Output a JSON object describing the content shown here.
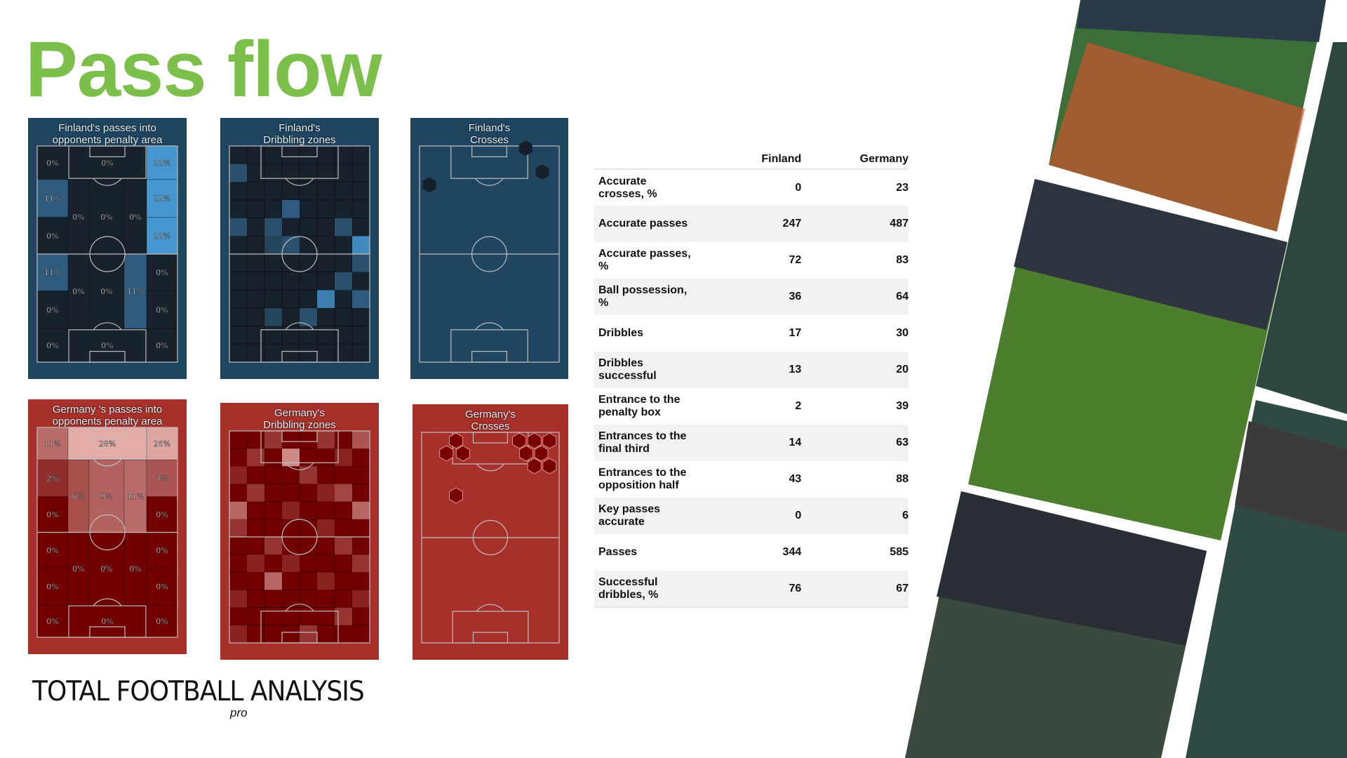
{
  "title": "Pass flow",
  "colors": {
    "title": "#7cbf4a",
    "finland_bg": "#1f4560",
    "germany_bg": "#a8302a",
    "finland_dark": "#17222c",
    "finland_high": "#4696cf",
    "germany_dark": "#730000",
    "germany_high": "#e3aca7"
  },
  "panels": {
    "finland_penalty": {
      "title1": "Finland's passes into",
      "title2": "opponents penalty area",
      "values": [
        "0%",
        "0%",
        "22%",
        "11%",
        "0%",
        "0%",
        "0%",
        "0%",
        "22%",
        "22%",
        "11%",
        "0%",
        "0%",
        "0%",
        "11%",
        "0%",
        "0%",
        "0%",
        "0%",
        "0%"
      ]
    },
    "finland_dribbling": {
      "title1": "Finland's",
      "title2": "Dribbling zones",
      "cells": [
        [
          1,
          0,
          0.4
        ],
        [
          3,
          3,
          0.5
        ],
        [
          4,
          0,
          0.4
        ],
        [
          4,
          2,
          0.4
        ],
        [
          4,
          6,
          0.4
        ],
        [
          5,
          2,
          0.3
        ],
        [
          5,
          3,
          0.4
        ],
        [
          5,
          7,
          0.9
        ],
        [
          6,
          7,
          0.4
        ],
        [
          7,
          6,
          0.4
        ],
        [
          8,
          5,
          0.8
        ],
        [
          8,
          7,
          0.5
        ],
        [
          9,
          4,
          0.4
        ],
        [
          9,
          2,
          0.3
        ]
      ]
    },
    "finland_crosses": {
      "title1": "Finland's",
      "title2": "Crosses",
      "points": [
        [
          0.07,
          0.18
        ],
        [
          0.88,
          0.12
        ],
        [
          0.76,
          0.01
        ]
      ]
    },
    "germany_penalty": {
      "title1": "Germany 's passes into",
      "title2": "opponents penalty area",
      "values": [
        "11%",
        "28%",
        "26%",
        "2%",
        "0%",
        "6%",
        "9%",
        "11%",
        "7%",
        "0%",
        "0%",
        "0%",
        "0%",
        "0%",
        "0%",
        "0%",
        "0%",
        "0%",
        "0%",
        "0%"
      ]
    },
    "germany_dribbling": {
      "title1": "Germany's",
      "title2": "Dribbling zones",
      "cells": [
        [
          0,
          2,
          0.3
        ],
        [
          0,
          5,
          0.3
        ],
        [
          0,
          7,
          0.5
        ],
        [
          1,
          3,
          0.8
        ],
        [
          1,
          1,
          0.3
        ],
        [
          1,
          6,
          0.2
        ],
        [
          2,
          0,
          0.2
        ],
        [
          2,
          4,
          0.3
        ],
        [
          3,
          1,
          0.3
        ],
        [
          3,
          5,
          0.2
        ],
        [
          3,
          6,
          0.4
        ],
        [
          4,
          0,
          0.6
        ],
        [
          4,
          7,
          0.6
        ],
        [
          4,
          3,
          0.2
        ],
        [
          5,
          0,
          0.3
        ],
        [
          5,
          5,
          0.2
        ],
        [
          6,
          2,
          0.3
        ],
        [
          6,
          6,
          0.3
        ],
        [
          7,
          1,
          0.2
        ],
        [
          7,
          3,
          0.2
        ],
        [
          7,
          7,
          0.3
        ],
        [
          8,
          2,
          0.6
        ],
        [
          8,
          5,
          0.2
        ],
        [
          9,
          0,
          0.2
        ],
        [
          9,
          7,
          0.2
        ],
        [
          10,
          6,
          0.3
        ],
        [
          11,
          4,
          0.3
        ],
        [
          11,
          0,
          0.2
        ]
      ]
    },
    "germany_crosses": {
      "title1": "Germany's",
      "title2": "Crosses",
      "points": [
        [
          0.25,
          0.04
        ],
        [
          0.18,
          0.1
        ],
        [
          0.3,
          0.1
        ],
        [
          0.71,
          0.04
        ],
        [
          0.82,
          0.04
        ],
        [
          0.93,
          0.04
        ],
        [
          0.76,
          0.1
        ],
        [
          0.87,
          0.1
        ],
        [
          0.82,
          0.16
        ],
        [
          0.93,
          0.16
        ],
        [
          0.25,
          0.3
        ]
      ]
    }
  },
  "table": {
    "headers": [
      "",
      "Finland",
      "Germany"
    ],
    "rows": [
      [
        "Accurate\ncrosses, %",
        "0",
        "23"
      ],
      [
        "Accurate passes",
        "247",
        "487"
      ],
      [
        "Accurate passes,\n%",
        "72",
        "83"
      ],
      [
        "Ball possession,\n%",
        "36",
        "64"
      ],
      [
        "Dribbles",
        "17",
        "30"
      ],
      [
        "Dribbles\nsuccessful",
        "13",
        "20"
      ],
      [
        "Entrance to the\npenalty box",
        "2",
        "39"
      ],
      [
        "Entrances to the\nfinal third",
        "14",
        "63"
      ],
      [
        "Entrances to the\nopposition half",
        "43",
        "88"
      ],
      [
        "Key passes\naccurate",
        "0",
        "6"
      ],
      [
        "Passes",
        "344",
        "585"
      ],
      [
        "Successful\ndribbles, %",
        "76",
        "67"
      ]
    ]
  },
  "logo": {
    "text": "TOTAL FOOTBALL ANALYSIS",
    "sub": "pro"
  }
}
